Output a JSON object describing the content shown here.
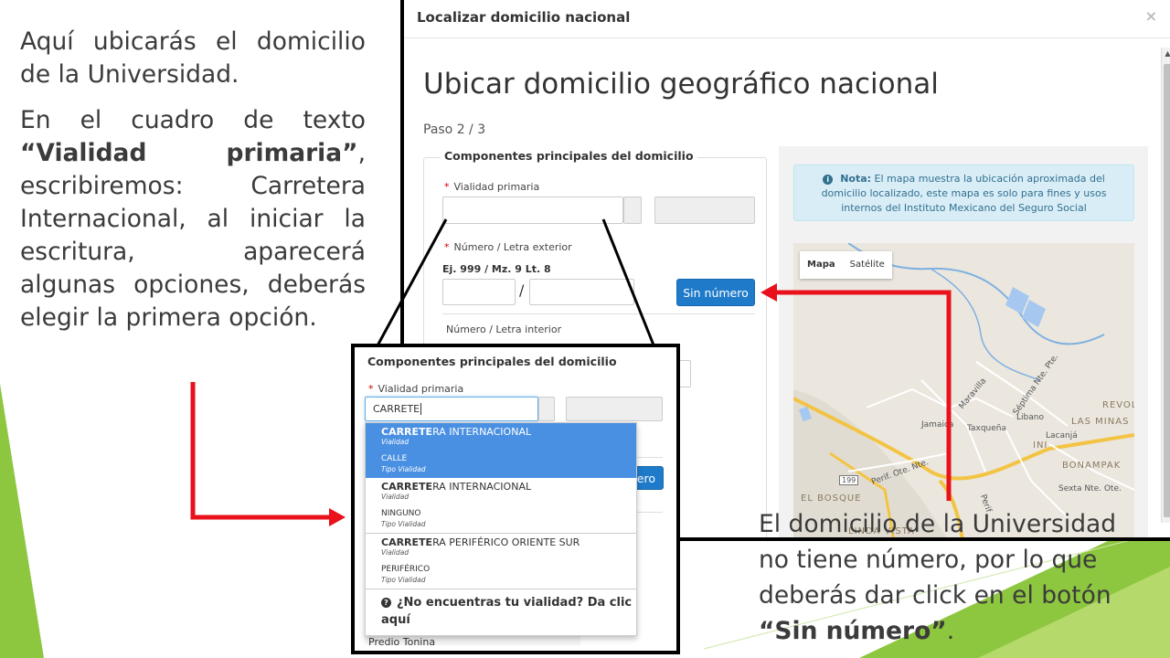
{
  "slide": {
    "left_p1": "Aquí ubicarás el domicilio de la Universidad.",
    "left_p2_a": "En el cuadro de texto ",
    "left_p2_bold": "“Vialidad primaria”",
    "left_p2_b": ", escribiremos: Carretera Internacional, al iniciar la escritura, aparecerá algunas opciones, deberás elegir la primera opción.",
    "right_a": "El domicilio de la Universidad no tiene número, por lo que deberás dar click en el botón ",
    "right_bold": "“Sin número”",
    "right_b": ".",
    "arrow_color": "#e8111c",
    "accent_green": "#8dc63f"
  },
  "modal": {
    "title": "Localizar domicilio nacional",
    "close": "×",
    "page_title": "Ubicar domicilio geográfico nacional",
    "step": "Paso 2 / 3",
    "legend": "Componentes principales del domicilio",
    "required_mark": "*",
    "vialidad_label": "Vialidad primaria",
    "numero_ext_label": "Número / Letra exterior",
    "numero_ext_hint": "Ej. 999 / Mz. 9 Lt. 8",
    "slash": "/",
    "sin_numero_button": "Sin número",
    "numero_int_label": "Número / Letra interior",
    "note_bold": "Nota:",
    "note_text": " El mapa muestra la ubicación aproximada del domicilio localizado, este mapa es solo para fines y usos internos del Instituto Mexicano del Seguro Social",
    "map_tab_mapa": "Mapa",
    "map_tab_satelite": "Satélite",
    "map_labels": {
      "revol": "REVOL",
      "las_minas": "LAS MINAS",
      "bonampak": "BONAMPAK",
      "el_bosque": "EL BOSQUE",
      "linda_vista": "LINDA VISTA",
      "ini": "INI",
      "jamaica": "Jamaica",
      "taxquena": "Taxqueña",
      "libano": "Libano",
      "lacanja": "Lacanjá",
      "septima": "Séptima Nte. Pte.",
      "sexta": "Sexta Nte. Ote.",
      "perif": "Perif. Ote. Nte.",
      "perif2": "Perif",
      "maravilla": "Maravilla",
      "route": "199"
    }
  },
  "zoom": {
    "legend": "Componentes principales del domicilio",
    "required_mark": "*",
    "vialidad_label": "Vialidad primaria",
    "input_value": "CARRETE",
    "partial_button": "ero",
    "options": [
      {
        "hl": "CARRETE",
        "rest": "RA INTERNACIONAL",
        "sub": "Vialidad"
      },
      {
        "hl": "",
        "rest": "CALLE",
        "sub": "Tipo Vialidad"
      },
      {
        "hl": "CARRETE",
        "rest": "RA INTERNACIONAL",
        "sub": "Vialidad"
      },
      {
        "hl": "",
        "rest": "NINGUNO",
        "sub": "Tipo Vialidad"
      },
      {
        "hl": "CARRETE",
        "rest": "RA PERIFÉRICO ORIENTE SUR",
        "sub": "Vialidad"
      },
      {
        "hl": "",
        "rest": "PERIFÉRICO",
        "sub": "Tipo Vialidad"
      }
    ],
    "not_found_icon": "?",
    "not_found": "¿No encuentras tu vialidad? Da clic aquí",
    "predio": "Predio Tonina"
  }
}
